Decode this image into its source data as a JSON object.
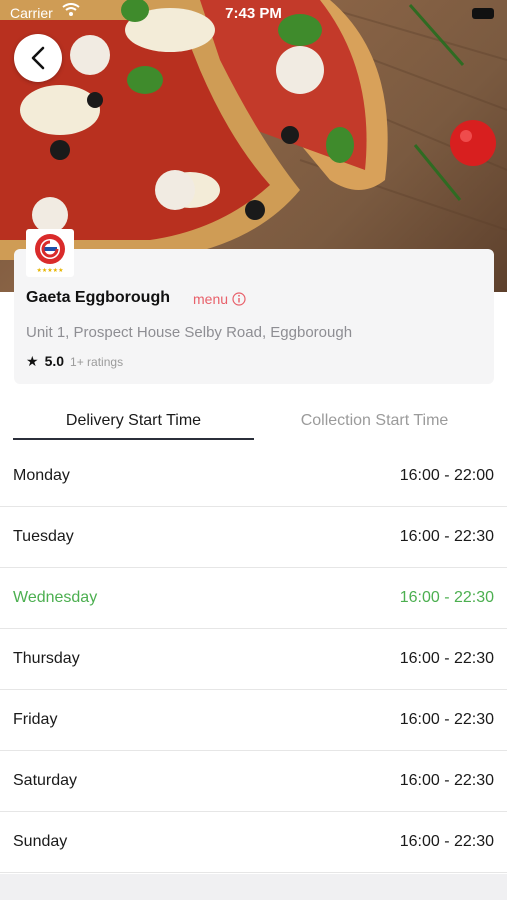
{
  "status_bar": {
    "carrier": "Carrier",
    "time": "7:43 PM"
  },
  "restaurant": {
    "name": "Gaeta Eggborough",
    "menu_label": "menu",
    "address": "Unit 1, Prospect House Selby Road, Eggborough",
    "rating": "5.0",
    "rating_count": "1+ ratings"
  },
  "tabs": [
    {
      "label": "Delivery Start Time",
      "active": true
    },
    {
      "label": "Collection Start Time",
      "active": false
    }
  ],
  "schedule": [
    {
      "day": "Monday",
      "hours": "16:00 - 22:00"
    },
    {
      "day": "Tuesday",
      "hours": "16:00 - 22:30"
    },
    {
      "day": "Wednesday",
      "hours": "16:00 - 22:30",
      "highlight": true
    },
    {
      "day": "Thursday",
      "hours": "16:00 - 22:30"
    },
    {
      "day": "Friday",
      "hours": "16:00 - 22:30"
    },
    {
      "day": "Saturday",
      "hours": "16:00 - 22:30"
    },
    {
      "day": "Sunday",
      "hours": "16:00 - 22:30"
    }
  ],
  "colors": {
    "accent_green": "#4caf50",
    "menu_red": "#e8606a",
    "logo_red": "#d92b2b",
    "logo_blue": "#1e4fa8"
  },
  "icons": {
    "back": "chevron-left-icon",
    "info": "info-circle-icon",
    "star": "star-icon"
  }
}
